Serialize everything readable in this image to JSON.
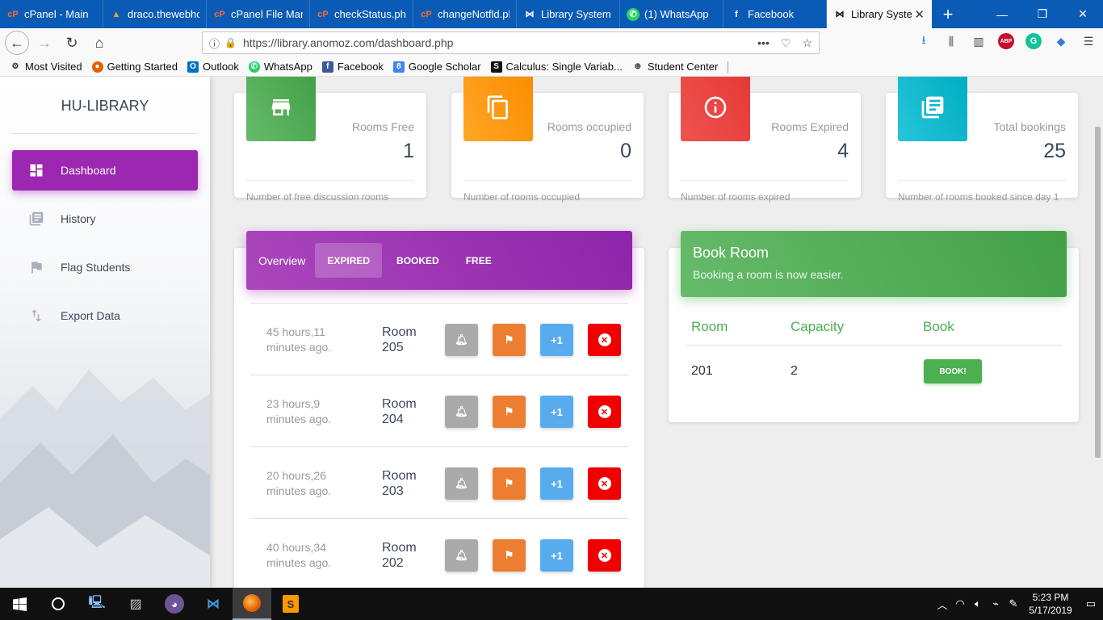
{
  "browser": {
    "tabs": [
      {
        "label": "cPanel - Main",
        "icon": "cpanel-icon"
      },
      {
        "label": "draco.thewebhost",
        "icon": "webhost-icon"
      },
      {
        "label": "cPanel File Mana",
        "icon": "cpanel-icon"
      },
      {
        "label": "checkStatus.php",
        "icon": "cpanel-icon"
      },
      {
        "label": "changeNotfld.ph",
        "icon": "cpanel-icon"
      },
      {
        "label": "Library System -",
        "icon": "library-icon"
      },
      {
        "label": "(1) WhatsApp",
        "icon": "whatsapp-icon"
      },
      {
        "label": "Facebook",
        "icon": "facebook-icon"
      }
    ],
    "active_tab": {
      "label": "Library Syste",
      "close": "✕"
    },
    "new_tab": "+",
    "url": "https://library.anomoz.com/dashboard.php",
    "bookmarks": [
      {
        "label": "Most Visited",
        "icon": "gear-icon"
      },
      {
        "label": "Getting Started",
        "icon": "firefox-icon"
      },
      {
        "label": "Outlook",
        "icon": "outlook-icon"
      },
      {
        "label": "WhatsApp",
        "icon": "whatsapp-icon"
      },
      {
        "label": "Facebook",
        "icon": "facebook-icon"
      },
      {
        "label": "Google Scholar",
        "icon": "scholar-icon"
      },
      {
        "label": "Calculus: Single Variab...",
        "icon": "coursera-icon"
      },
      {
        "label": "Student Center",
        "icon": "globe-icon"
      }
    ]
  },
  "sidebar": {
    "brand": "HU-LIBRARY",
    "items": [
      {
        "label": "Dashboard",
        "icon": "dashboard-icon",
        "active": true
      },
      {
        "label": "History",
        "icon": "history-icon",
        "active": false
      },
      {
        "label": "Flag Students",
        "icon": "flag-icon",
        "active": false
      },
      {
        "label": "Export Data",
        "icon": "export-icon",
        "active": false
      }
    ]
  },
  "stats": [
    {
      "category": "Rooms Free",
      "value": "1",
      "footer": "Number of free discussion rooms",
      "color": "#4caf50",
      "icon": "store-icon"
    },
    {
      "category": "Rooms occupied",
      "value": "0",
      "footer": "Number of rooms occupied",
      "color": "#ff9800",
      "icon": "copy-icon"
    },
    {
      "category": "Rooms Expired",
      "value": "4",
      "footer": "Number of rooms expired",
      "color": "#f44336",
      "icon": "info-icon"
    },
    {
      "category": "Total bookings",
      "value": "25",
      "footer": "Number of rooms booked since day 1",
      "color": "#00bcd4",
      "icon": "library-books-icon"
    }
  ],
  "overview": {
    "label": "Overview",
    "tabs": [
      {
        "label": "EXPIRED",
        "active": true
      },
      {
        "label": "BOOKED",
        "active": false
      },
      {
        "label": "FREE",
        "active": false
      }
    ],
    "rows": [
      {
        "time_line1": "45 hours,11",
        "time_line2": "minutes ago.",
        "room_line1": "Room",
        "room_line2": "205",
        "plus": "+1"
      },
      {
        "time_line1": "23 hours,9",
        "time_line2": "minutes ago.",
        "room_line1": "Room",
        "room_line2": "204",
        "plus": "+1"
      },
      {
        "time_line1": "20 hours,26",
        "time_line2": "minutes ago.",
        "room_line1": "Room",
        "room_line2": "203",
        "plus": "+1"
      },
      {
        "time_line1": "40 hours,34",
        "time_line2": "minutes ago.",
        "room_line1": "Room",
        "room_line2": "202",
        "plus": "+1"
      }
    ]
  },
  "book_room": {
    "title": "Book Room",
    "subtitle": "Booking a room is now easier.",
    "headers": [
      "Room",
      "Capacity",
      "Book"
    ],
    "rows": [
      {
        "room": "201",
        "capacity": "2",
        "button": "BOOK!"
      }
    ]
  },
  "taskbar": {
    "time": "5:23 PM",
    "date": "5/17/2019"
  },
  "colors": {
    "primary": "#9c27b0",
    "success": "#4caf50",
    "tab_bar": "#0a5bb5"
  }
}
